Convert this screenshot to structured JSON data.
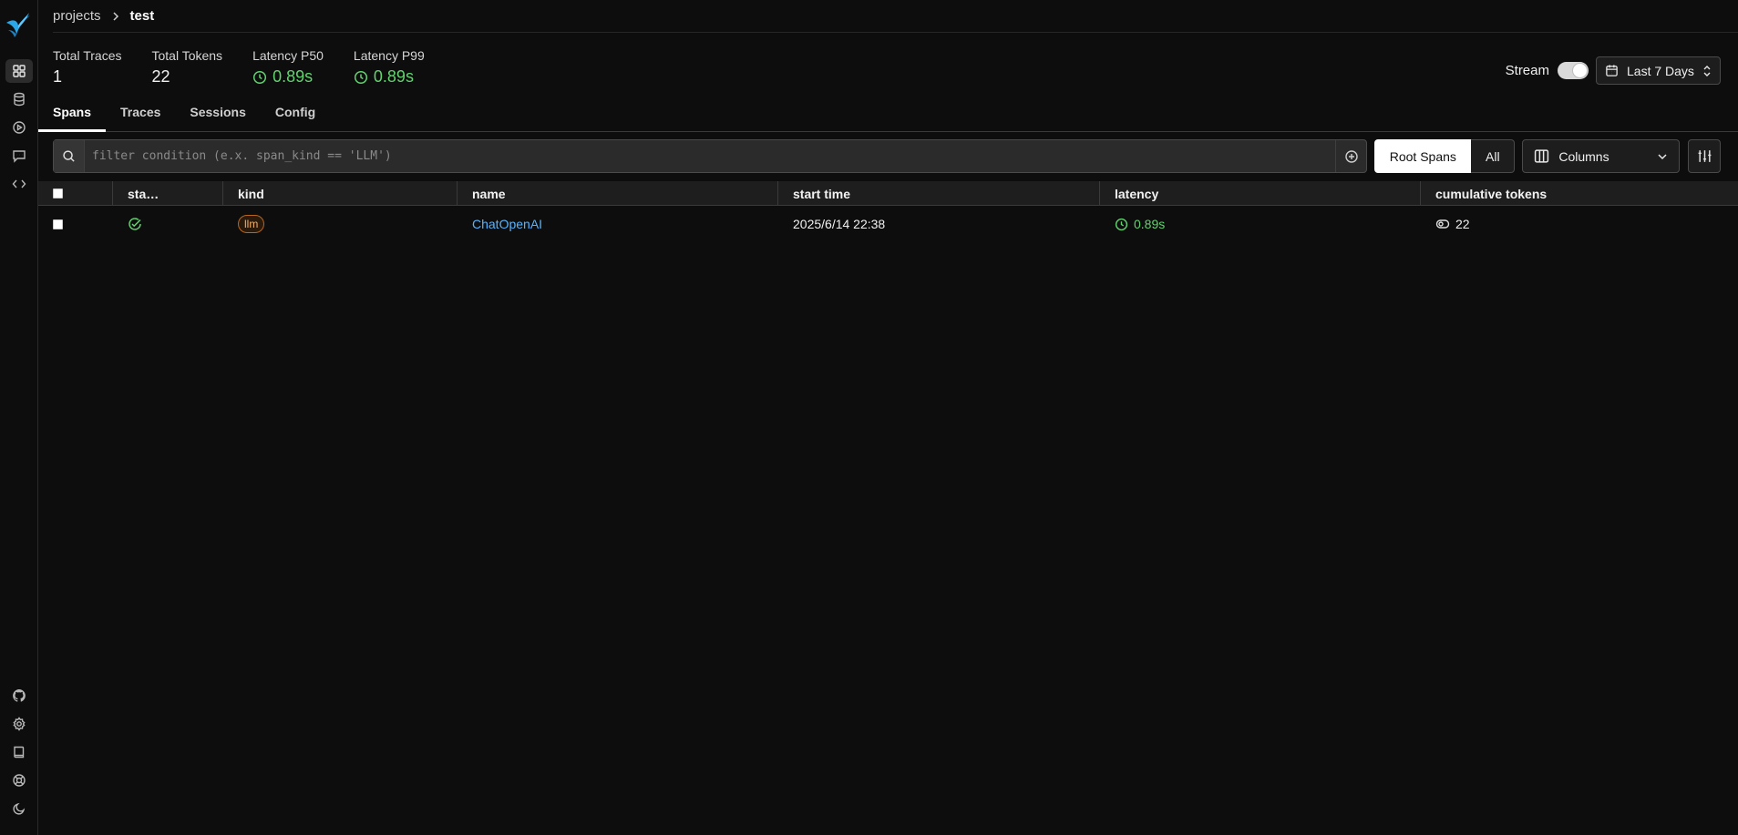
{
  "breadcrumb": {
    "root": "projects",
    "current": "test"
  },
  "stats": [
    {
      "label": "Total Traces",
      "value": "1",
      "icon": ""
    },
    {
      "label": "Total Tokens",
      "value": "22",
      "icon": ""
    },
    {
      "label": "Latency P50",
      "value": "0.89s",
      "icon": "clock-icon"
    },
    {
      "label": "Latency P99",
      "value": "0.89s",
      "icon": "clock-icon"
    }
  ],
  "controls": {
    "stream_label": "Stream",
    "stream_on": true,
    "date_range": "Last 7 Days"
  },
  "tabs": [
    {
      "label": "Spans",
      "active": true
    },
    {
      "label": "Traces",
      "active": false
    },
    {
      "label": "Sessions",
      "active": false
    },
    {
      "label": "Config",
      "active": false
    }
  ],
  "filter": {
    "placeholder": "filter condition (e.x. span_kind == 'LLM')",
    "root_spans": "Root Spans",
    "all": "All",
    "columns": "Columns"
  },
  "table": {
    "headers": [
      "sta…",
      "kind",
      "name",
      "start time",
      "latency",
      "cumulative tokens"
    ],
    "rows": [
      {
        "status": "ok",
        "kind": "llm",
        "name": "ChatOpenAI",
        "start_time": "2025/6/14 22:38",
        "latency": "0.89s",
        "tokens": "22"
      }
    ]
  },
  "colors": {
    "accent_green": "#62d26f",
    "link_blue": "#56b4ff",
    "llm_badge": "#b7651f"
  }
}
